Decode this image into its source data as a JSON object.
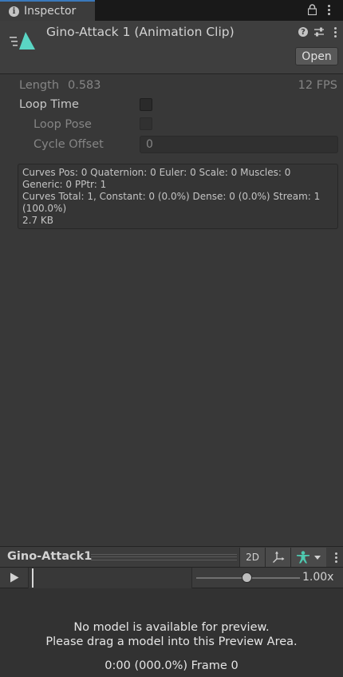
{
  "tab": {
    "label": "Inspector",
    "icon": "info-icon"
  },
  "header": {
    "title": "Gino-Attack 1 (Animation Clip)",
    "open_label": "Open",
    "icon_color": "#5ad5c4"
  },
  "clip": {
    "length_label": "Length",
    "length_value": "0.583",
    "fps": "12 FPS",
    "loop_time_label": "Loop Time",
    "loop_time_checked": false,
    "loop_pose_label": "Loop Pose",
    "loop_pose_checked": false,
    "cycle_offset_label": "Cycle Offset",
    "cycle_offset_value": "0"
  },
  "info": {
    "lines": [
      "Curves Pos: 0 Quaternion: 0 Euler: 0 Scale: 0 Muscles: 0",
      "Generic: 0 PPtr: 1",
      "Curves Total: 1, Constant: 0 (0.0%) Dense: 0 (0.0%) Stream: 1",
      "(100.0%)",
      "2.7 KB"
    ]
  },
  "preview": {
    "title": "Gino-Attack1",
    "btn_2d": "2D",
    "speed_value": "1.00x",
    "speed_fraction": 0.49,
    "message_line1": "No model is available for preview.",
    "message_line2": "Please drag a model into this Preview Area.",
    "frame_readout": "0:00 (000.0%) Frame 0",
    "avatar_color": "#4ec9b0"
  }
}
